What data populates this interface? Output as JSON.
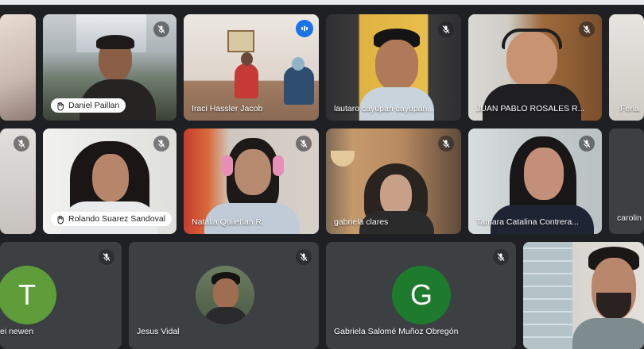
{
  "participants": [
    {
      "name": "",
      "muted": false
    },
    {
      "name": "Daniel Paillan",
      "muted": true
    },
    {
      "name": "Iraci Hassler Jacob",
      "muted": false,
      "speaking": true
    },
    {
      "name": "lautaro cayupan cayupan...",
      "muted": true
    },
    {
      "name": "JUAN PABLO ROSALES R...",
      "muted": true
    },
    {
      "name": "Feria",
      "muted": false
    },
    {
      "name": "",
      "muted": true
    },
    {
      "name": "Rolando Suarez Sandoval",
      "muted": true
    },
    {
      "name": "Natalia Quileñan R.",
      "muted": true
    },
    {
      "name": "gabriela clares",
      "muted": true
    },
    {
      "name": "Tamara Catalina Contrera...",
      "muted": true
    },
    {
      "name": "carolin",
      "muted": false
    },
    {
      "name": "ei newen",
      "muted": true,
      "avatar_letter": "T",
      "avatar_color": "#5e9d3a"
    },
    {
      "name": "Jesus Vidal",
      "muted": true
    },
    {
      "name": "Gabriela Salomé Muñoz Obregón",
      "muted": true,
      "avatar_letter": "G",
      "avatar_color": "#1e7a2c"
    },
    {
      "name": "",
      "muted": false
    }
  ],
  "colors": {
    "background": "#1f2023",
    "tile": "#3c4043",
    "speaking_border": "#8ab4f8",
    "speaking_indicator": "#1a73e8"
  },
  "icons": {
    "mute": "mic-off-icon",
    "speaking": "audio-level-icon",
    "hand": "raised-hand-icon"
  }
}
